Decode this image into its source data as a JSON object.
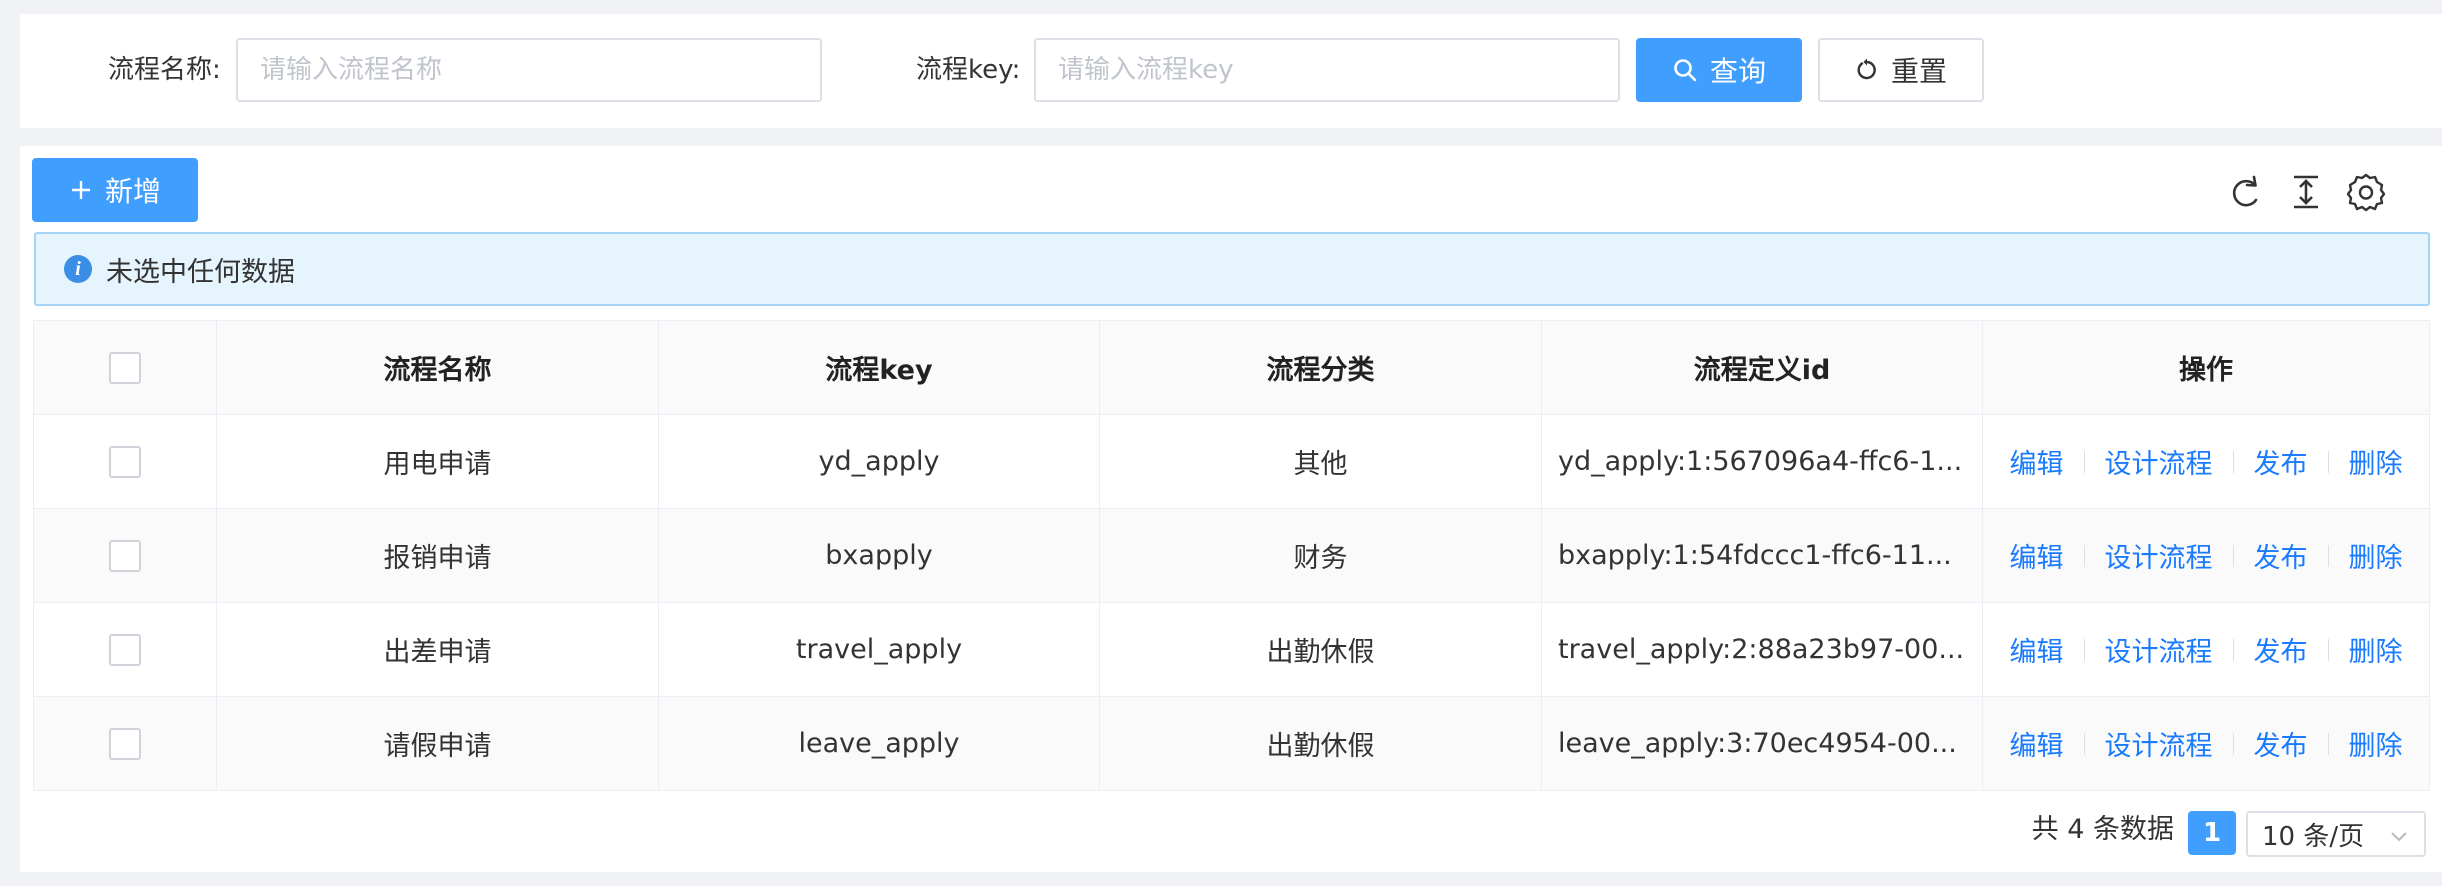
{
  "search": {
    "name_label": "流程名称:",
    "name_placeholder": "请输入流程名称",
    "name_value": "",
    "key_label": "流程key:",
    "key_placeholder": "请输入流程key",
    "key_value": "",
    "query_label": "查询",
    "reset_label": "重置"
  },
  "toolbar": {
    "add_label": "新增",
    "icons": [
      "refresh-icon",
      "column-height-icon",
      "settings-icon"
    ]
  },
  "alert": {
    "text": "未选中任何数据"
  },
  "table": {
    "columns": [
      "流程名称",
      "流程key",
      "流程分类",
      "流程定义id",
      "操作"
    ],
    "rows": [
      {
        "name": "用电申请",
        "key": "yd_apply",
        "category": "其他",
        "def_id": "yd_apply:1:567096a4-ffc6-1..."
      },
      {
        "name": "报销申请",
        "key": "bxapply",
        "category": "财务",
        "def_id": "bxapply:1:54fdccc1-ffc6-11..."
      },
      {
        "name": "出差申请",
        "key": "travel_apply",
        "category": "出勤休假",
        "def_id": "travel_apply:2:88a23b97-00..."
      },
      {
        "name": "请假申请",
        "key": "leave_apply",
        "category": "出勤休假",
        "def_id": "leave_apply:3:70ec4954-00..."
      }
    ],
    "actions": [
      "编辑",
      "设计流程",
      "发布",
      "删除"
    ]
  },
  "pagination": {
    "total_text": "共 4 条数据",
    "current_page": "1",
    "page_size": "10 条/页"
  },
  "colors": {
    "primary": "#409eff",
    "link": "#1a7bff",
    "alert_bg": "#e6f4fd"
  }
}
